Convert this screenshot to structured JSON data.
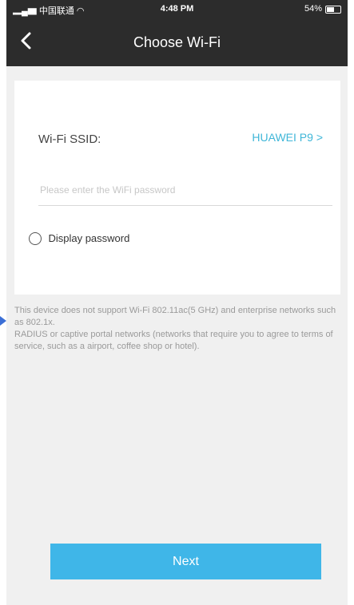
{
  "status_bar": {
    "carrier": "中国联通",
    "time": "4:48 PM",
    "battery": "54%"
  },
  "header": {
    "title": "Choose Wi-Fi"
  },
  "form": {
    "ssid_label": "Wi-Fi SSID:",
    "ssid_value": "HUAWEI P9",
    "password_placeholder": "Please enter the WiFi password",
    "password_value": "",
    "display_password_label": "Display password"
  },
  "notice": {
    "line1": "This device does not support Wi-Fi 802.11ac(5 GHz) and enterprise networks such as 802.1x.",
    "line2": "RADIUS or captive portal networks (networks that require you to agree to terms of service, such as a airport, coffee shop or hotel)."
  },
  "footer": {
    "next_label": "Next"
  },
  "colors": {
    "accent": "#3fb6e8",
    "header_bg": "#2c2c2c",
    "page_bg": "#f0f0f0"
  }
}
